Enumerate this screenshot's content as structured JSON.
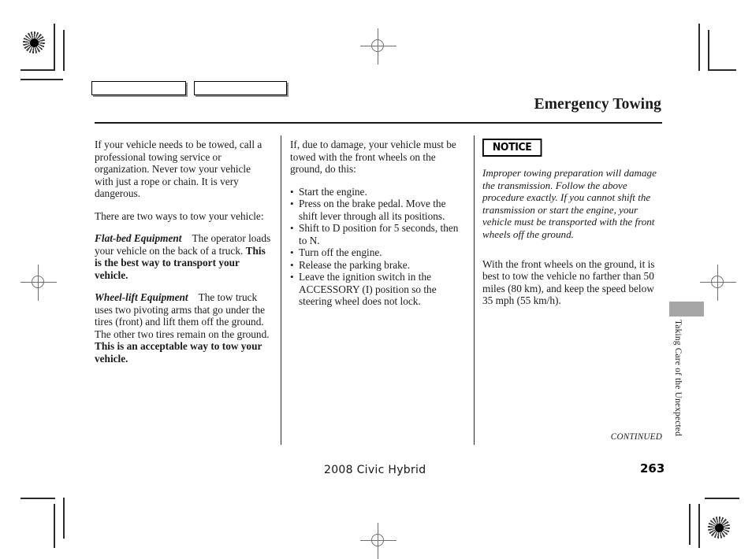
{
  "document": {
    "title": "Emergency Towing",
    "footer_model": "2008  Civic  Hybrid",
    "page_number": "263",
    "continued_label": "CONTINUED",
    "side_tab_label": "Taking Care of the Unexpected"
  },
  "column_1": {
    "para_1": "If your vehicle needs to be towed, call a professional towing service or organization. Never tow your vehicle with just a rope or chain. It is very dangerous.",
    "para_2": "There are two ways to tow your vehicle:",
    "flatbed": {
      "runhead": "Flat-bed Equipment",
      "normal": "The operator loads your vehicle on the back of a truck.",
      "bold": "This is the best way to transport your vehicle."
    },
    "wheellift": {
      "runhead": "Wheel-lift Equipment",
      "normal": "The tow truck uses two pivoting arms that go under the tires (front) and lift them off the ground. The other two tires remain on the ground.",
      "bold": "This is an acceptable way to tow your vehicle."
    }
  },
  "column_2": {
    "intro": "If, due to damage, your vehicle must be towed with the front wheels on the ground, do this:",
    "steps": [
      "Start the engine.",
      "Press on the brake pedal. Move the shift lever through all its positions.",
      "Shift to D position for 5 seconds, then to N.",
      "Turn off the engine.",
      "Release the parking brake.",
      "Leave the ignition switch in the ACCESSORY (I) position so the steering wheel does not lock."
    ]
  },
  "column_3": {
    "notice_label": "NOTICE",
    "notice_text": "Improper towing preparation will damage the transmission. Follow the above procedure exactly. If you cannot shift the transmission or start the engine, your vehicle must be transported with the front wheels off the ground.",
    "para_after": "With the front wheels on the ground, it is best to tow the vehicle no farther than 50 miles (80 km), and keep the speed below 35 mph (55 km/h)."
  },
  "colors": {
    "ink": "#1a1a1a",
    "rule": "#2b2b2b",
    "thumb_tab": "#a6a6a6",
    "reg_mark": "#6e6e6e"
  }
}
